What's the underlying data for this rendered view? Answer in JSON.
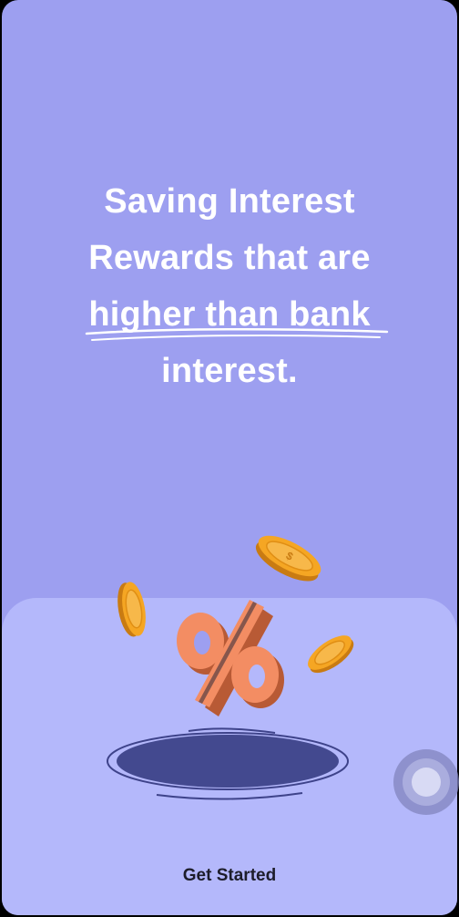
{
  "onboarding": {
    "headline_line1": "Saving Interest",
    "headline_line2": "Rewards that are",
    "headline_line3": "higher than bank",
    "headline_line4": "interest.",
    "cta_label": "Get Started"
  },
  "colors": {
    "background_top": "#9d9ff0",
    "background_bottom": "#b4b8fb",
    "coin": "#f5a623",
    "percent_sign": "#f08a5d",
    "hole": "#43498f"
  },
  "icons": {
    "illustration": "percent-coins-hole-illustration",
    "assistive": "assistive-touch-icon"
  }
}
